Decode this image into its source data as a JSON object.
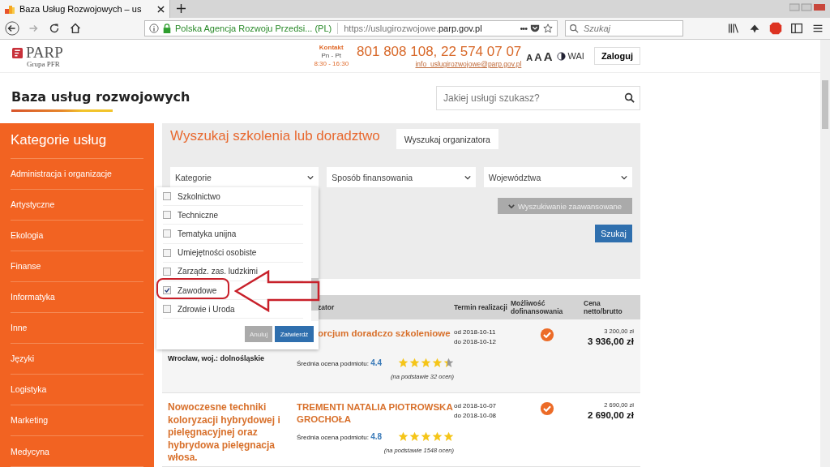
{
  "browser": {
    "tab_title": "Baza Usług Rozwojowych – us",
    "identity": "Polska Agencja Rozwoju Przedsi... (PL)",
    "url_prefix": "https://uslugirozwojowe.",
    "url_domain": "parp.gov.pl",
    "page_actions": "•••",
    "search": {
      "placeholder": "Szukaj"
    }
  },
  "header": {
    "logo": "PARP",
    "logo_sub": "Grupa PFR",
    "contact_label": "Kontakt",
    "contact_days": "Pn - Pt",
    "contact_hours": "8:30 - 16:30",
    "phone": "801 808 108, 22 574 07 07",
    "email": "info_uslugirozwojowe@parp.gov.pl",
    "font_sizes": [
      "A",
      "A",
      "A"
    ],
    "wai": "WAI",
    "login": "Zaloguj"
  },
  "site_title": "Baza usług rozwojowych",
  "site_search": {
    "placeholder": "Jakiej usługi szukasz?"
  },
  "sidebar": {
    "title": "Kategorie usług",
    "items": [
      "Administracja i organizacje",
      "Artystyczne",
      "Ekologia",
      "Finanse",
      "Informatyka",
      "Inne",
      "Języki",
      "Logistyka",
      "Marketing",
      "Medycyna"
    ]
  },
  "tabs": [
    {
      "label": "Wyszukaj szkolenia lub doradztwo",
      "selected": true
    },
    {
      "label": "Wyszukaj organizatora",
      "selected": false
    }
  ],
  "filters": [
    "Kategorie",
    "Sposób finansowania",
    "Województwa"
  ],
  "advanced_search": "Wyszukiwanie zaawansowane",
  "search_button": "Szukaj",
  "category_dropdown": {
    "options": [
      {
        "label": "Szkolnictwo",
        "checked": false
      },
      {
        "label": "Techniczne",
        "checked": false
      },
      {
        "label": "Tematyka unijna",
        "checked": false
      },
      {
        "label": "Umiejętności osobiste",
        "checked": false
      },
      {
        "label": "Zarządz. zas. ludzkimi",
        "checked": false
      },
      {
        "label": "Zawodowe",
        "checked": true
      },
      {
        "label": "Zdrowie i Uroda",
        "checked": false
      }
    ],
    "cancel": "Anuluj",
    "confirm": "Zatwierdź"
  },
  "table": {
    "columns": [
      "zator",
      "Termin realizacji",
      "Możliwość dofinansowania",
      "Cena netto/brutto"
    ],
    "rows": [
      {
        "title": "",
        "location": "Wrocław, woj.: dolnośląskie",
        "organizer": "orcjum doradczo szkoleniowe",
        "rating_label": "Średnia ocena podmiotu:",
        "rating": "4.4",
        "stars": 4.4,
        "reviews": "(na podstawie 32 ocen)",
        "date_from": "od 2018-10-11",
        "date_to": "do 2018-10-12",
        "funding": true,
        "price_net": "3 200,00 zł",
        "price_gross": "3 936,00 zł"
      },
      {
        "title": "Nowoczesne techniki koloryzacji hybrydowej i pielęgnacyjnej oraz hybrydowa pielęgnacja włosa.",
        "location": "",
        "organizer": "TREMENTI NATALIA PIOTROWSKA GROCHOŁA",
        "rating_label": "Średnia ocena podmiotu:",
        "rating": "4.8",
        "stars": 5,
        "reviews": "(na podstawie 1548 ocen)",
        "date_from": "od 2018-10-07",
        "date_to": "do 2018-10-08",
        "funding": true,
        "price_net": "2 690,00 zł",
        "price_gross": "2 690,00 zł"
      }
    ]
  }
}
